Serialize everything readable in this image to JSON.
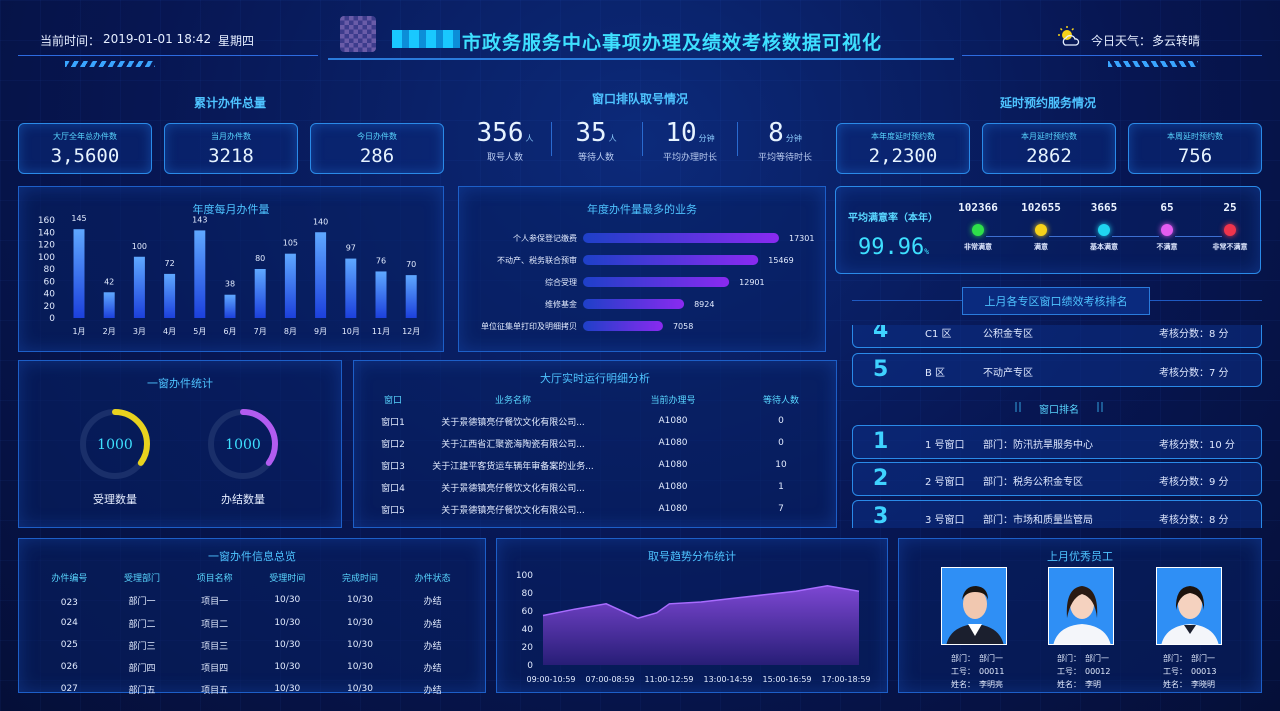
{
  "header": {
    "time_label": "当前时间：",
    "time_value": "2019-01-01  18:42",
    "weekday": "星期四",
    "title": "市政务服务中心事项办理及绩效考核数据可视化",
    "weather_label": "今日天气：",
    "weather_value": "多云转晴"
  },
  "totals": {
    "section": "累计办件总量",
    "cards": [
      {
        "label": "大厅全年总办件数",
        "value": "3,5600"
      },
      {
        "label": "当月办件数",
        "value": "3218"
      },
      {
        "label": "今日办件数",
        "value": "286"
      }
    ]
  },
  "queue": {
    "section": "窗口排队取号情况",
    "items": [
      {
        "value": "356",
        "unit": "人",
        "label": "取号人数"
      },
      {
        "value": "35",
        "unit": "人",
        "label": "等待人数"
      },
      {
        "value": "10",
        "unit": "分钟",
        "label": "平均办理时长"
      },
      {
        "value": "8",
        "unit": "分钟",
        "label": "平均等待时长"
      }
    ]
  },
  "delay": {
    "section": "延时预约服务情况",
    "cards": [
      {
        "label": "本年度延时预约数",
        "value": "2,2300"
      },
      {
        "label": "本月延时预约数",
        "value": "2862"
      },
      {
        "label": "本周延时预约数",
        "value": "756"
      }
    ]
  },
  "monthly": {
    "title": "年度每月办件量"
  },
  "top_business": {
    "title": "年度办件量最多的业务"
  },
  "satisfaction": {
    "label": "平均满意率（本年）",
    "value": "99.96",
    "unit": "%",
    "items": [
      {
        "count": "102366",
        "label": "非常满意",
        "color": "#2ee04a"
      },
      {
        "count": "102655",
        "label": "满意",
        "color": "#f6d21a"
      },
      {
        "count": "3665",
        "label": "基本满意",
        "color": "#1fd6f0"
      },
      {
        "count": "65",
        "label": "不满意",
        "color": "#e35cf0"
      },
      {
        "count": "25",
        "label": "非常不满意",
        "color": "#f0344c"
      }
    ]
  },
  "ranking": {
    "title": "上月各专区窗口绩效考核排名",
    "zones": [
      {
        "rank": "4",
        "name": "C1 区",
        "dept": "公积金专区",
        "score": "考核分数：8 分"
      },
      {
        "rank": "5",
        "name": "B 区",
        "dept": "不动产专区",
        "score": "考核分数：7 分"
      }
    ],
    "window_title": "窗口排名",
    "windows": [
      {
        "rank": "1",
        "name": "1 号窗口",
        "dept": "部门：防汛抗旱服务中心",
        "score": "考核分数：10 分"
      },
      {
        "rank": "2",
        "name": "2 号窗口",
        "dept": "部门：税务公积金专区",
        "score": "考核分数：9 分"
      },
      {
        "rank": "3",
        "name": "3 号窗口",
        "dept": "部门：市场和质量监管局",
        "score": "考核分数：8 分"
      }
    ]
  },
  "one_window": {
    "title": "一窗办件统计",
    "rings": [
      {
        "value": "1000",
        "label": "受理数量",
        "color": "#e8d21e",
        "fraction": 0.35
      },
      {
        "value": "1000",
        "label": "办结数量",
        "color": "#b25cf0",
        "fraction": 0.35
      }
    ]
  },
  "hall": {
    "title": "大厅实时运行明细分析",
    "headers": [
      "窗口",
      "业务名称",
      "当前办理号",
      "等待人数"
    ],
    "rows": [
      [
        "窗口1",
        "关于景德镇亮仔餐饮文化有限公司...",
        "A1080",
        "0"
      ],
      [
        "窗口2",
        "关于江西省汇聚瓷海陶瓷有限公司...",
        "A1080",
        "0"
      ],
      [
        "窗口3",
        "关于江建平客货运车辆年审备案的业务...",
        "A1080",
        "10"
      ],
      [
        "窗口4",
        "关于景德镇亮仔餐饮文化有限公司...",
        "A1080",
        "1"
      ],
      [
        "窗口5",
        "关于景德镇亮仔餐饮文化有限公司...",
        "A1080",
        "7"
      ]
    ]
  },
  "info": {
    "title": "一窗办件信息总览",
    "headers": [
      "办件编号",
      "受理部门",
      "项目名称",
      "受理时间",
      "完成时间",
      "办件状态"
    ],
    "rows": [
      [
        "023",
        "部门一",
        "项目一",
        "10/30",
        "10/30",
        "办结"
      ],
      [
        "024",
        "部门二",
        "项目二",
        "10/30",
        "10/30",
        "办结"
      ],
      [
        "025",
        "部门三",
        "项目三",
        "10/30",
        "10/30",
        "办结"
      ],
      [
        "026",
        "部门四",
        "项目四",
        "10/30",
        "10/30",
        "办结"
      ],
      [
        "027",
        "部门五",
        "项目五",
        "10/30",
        "10/30",
        "办结"
      ]
    ]
  },
  "trend": {
    "title": "取号趋势分布统计"
  },
  "employees": {
    "title": "上月优秀员工",
    "people": [
      {
        "dept": "部门：　部门一",
        "id": "工号：　00011",
        "name": "姓名：　李明亮"
      },
      {
        "dept": "部门：　部门一",
        "id": "工号：　00012",
        "name": "姓名：　李明"
      },
      {
        "dept": "部门：　部门一",
        "id": "工号：　00013",
        "name": "姓名：　李晓明"
      }
    ]
  },
  "chart_data": [
    {
      "type": "bar",
      "title": "年度每月办件量",
      "categories": [
        "1月",
        "2月",
        "3月",
        "4月",
        "5月",
        "6月",
        "7月",
        "8月",
        "9月",
        "10月",
        "11月",
        "12月"
      ],
      "values": [
        145,
        42,
        100,
        72,
        143,
        38,
        80,
        105,
        140,
        97,
        76,
        70
      ],
      "ylim": [
        0,
        160
      ],
      "yticks": [
        0,
        20,
        40,
        60,
        80,
        100,
        120,
        140,
        160
      ]
    },
    {
      "type": "bar",
      "orientation": "horizontal",
      "title": "年度办件量最多的业务",
      "categories": [
        "个人参保登记缴费",
        "不动产、税务联合预审",
        "综合受理",
        "维修基金",
        "单位征集单打印及明细拷贝"
      ],
      "values": [
        17301,
        15469,
        12901,
        8924,
        7058
      ]
    },
    {
      "type": "area",
      "title": "取号趋势分布统计",
      "categories": [
        "09:00-10:59",
        "07:00-08:59",
        "11:00-12:59",
        "13:00-14:59",
        "15:00-16:59",
        "17:00-18:59"
      ],
      "x": [
        0,
        0.5,
        1,
        1.5,
        1.8,
        2,
        2.5,
        3,
        3.5,
        4,
        4.5,
        5
      ],
      "values": [
        55,
        62,
        68,
        52,
        58,
        68,
        70,
        74,
        78,
        82,
        88,
        82
      ],
      "ylim": [
        0,
        100
      ],
      "yticks": [
        0,
        20,
        40,
        60,
        80,
        100
      ]
    }
  ]
}
